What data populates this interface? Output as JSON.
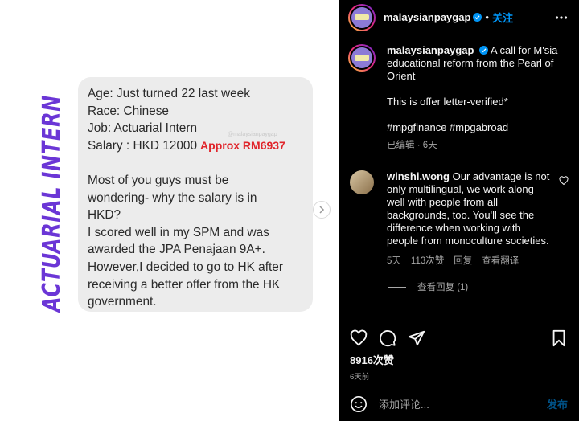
{
  "media": {
    "side_title": "ACTUARIAL INTERN",
    "watermark": "@malaysianpaygap",
    "lines": [
      {
        "text": "Age: Just turned 22 last week"
      },
      {
        "text": "Race: Chinese"
      },
      {
        "text": "Job: Actuarial Intern"
      },
      {
        "text": "Salary : HKD 12000",
        "highlight": "Approx RM6937"
      },
      {
        "gap": true
      },
      {
        "text": "Most of you guys must be"
      },
      {
        "text": "wondering- why the salary is in"
      },
      {
        "text": "HKD?"
      },
      {
        "text": "I scored well in my SPM and was"
      },
      {
        "text": "awarded the JPA Penajaan 9A+."
      },
      {
        "text": "However,I decided to go to HK after"
      },
      {
        "text": "receiving a better offer from the HK"
      },
      {
        "text": "government."
      }
    ],
    "colors": {
      "title": "#6b36d6",
      "highlight": "#e0252b",
      "bubble": "#ececec"
    }
  },
  "header": {
    "username": "malaysianpaygap",
    "separator": "•",
    "follow_label": "关注"
  },
  "caption": {
    "username": "malaysianpaygap",
    "text": "A call for M'sia educational reform from the Pearl of Orient",
    "line2": "This is offer letter-verified*",
    "hashtags": "#mpgfinance #mpgabroad",
    "meta": "已编辑 · 6天"
  },
  "comment": {
    "username": "winshi.wong",
    "text": "Our advantage is not only multilingual, we work along well with people from all backgrounds, too. You'll see the difference when working with people from monoculture societies.",
    "age": "5天",
    "likes": "113次赞",
    "reply": "回复",
    "translate": "查看翻译",
    "view_replies": "查看回复 (1)"
  },
  "actions": {
    "likes_count": "8916次赞",
    "time_ago": "6天前"
  },
  "comment_box": {
    "placeholder": "添加评论...",
    "post_label": "发布"
  },
  "colors": {
    "accent": "#0095f6",
    "panel_bg": "#000000",
    "muted": "#a8a8a8"
  }
}
